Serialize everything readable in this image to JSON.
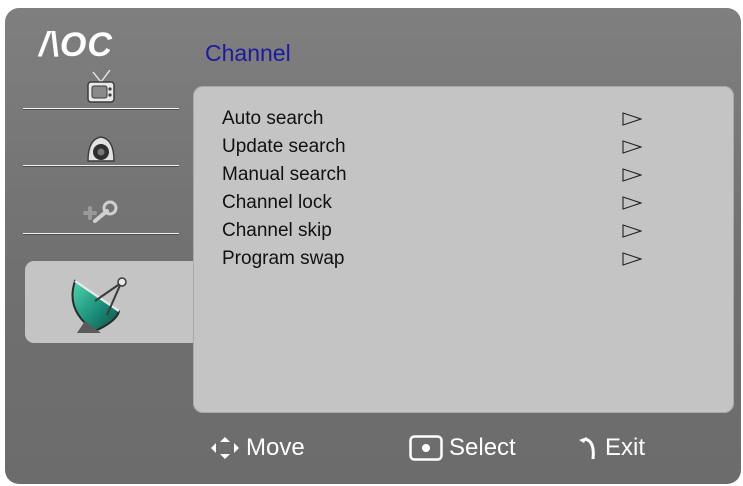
{
  "brand": {
    "logo": "/\\OC"
  },
  "header": {
    "title": "Channel"
  },
  "sidebar": {
    "items": [
      {
        "name": "tv",
        "icon": "tv-icon"
      },
      {
        "name": "audio",
        "icon": "speaker-icon"
      },
      {
        "name": "setup",
        "icon": "tools-icon"
      },
      {
        "name": "channel",
        "icon": "satellite-dish-icon",
        "active": true
      }
    ]
  },
  "menu": {
    "items": [
      {
        "label": "Auto search"
      },
      {
        "label": "Update search"
      },
      {
        "label": "Manual search"
      },
      {
        "label": "Channel lock"
      },
      {
        "label": "Channel skip"
      },
      {
        "label": "Program swap"
      }
    ]
  },
  "footer": {
    "move": "Move",
    "select": "Select",
    "exit": "Exit"
  },
  "colors": {
    "frame": "#747474",
    "panel": "#c4c4c4",
    "title": "#1b1aa0",
    "text": "#111111",
    "footer_text": "#ffffff"
  }
}
